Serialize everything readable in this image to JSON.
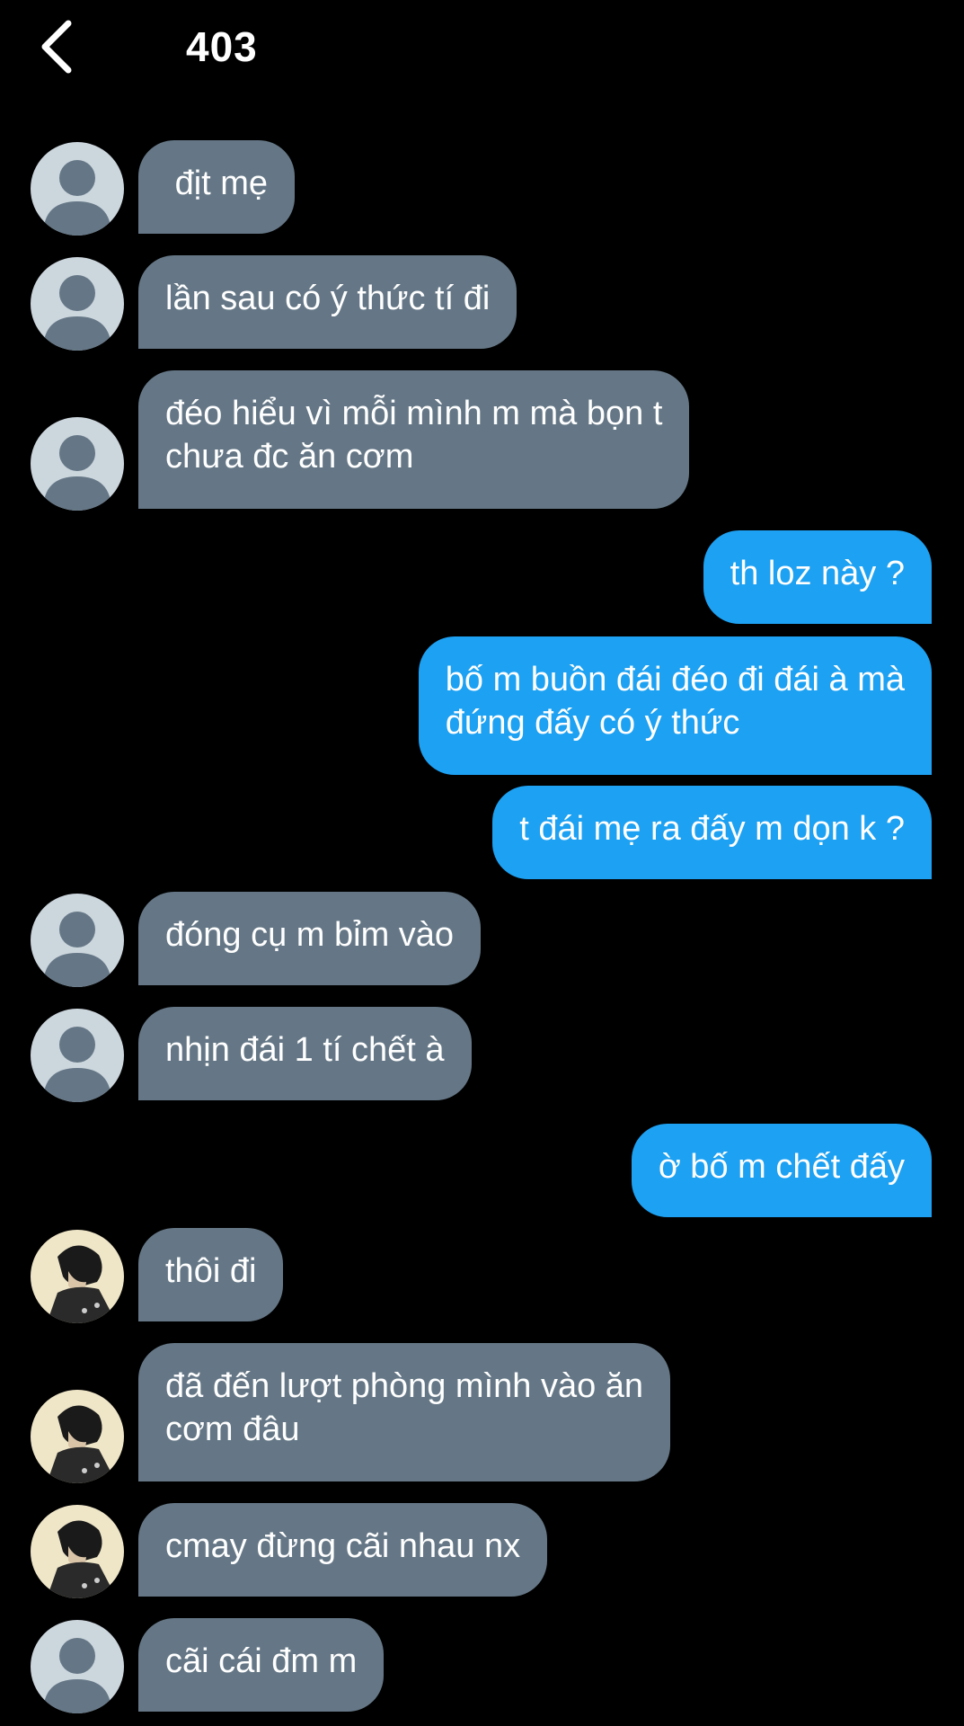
{
  "header": {
    "back_icon": "chevron-left-icon",
    "title": "403"
  },
  "colors": {
    "background": "#000000",
    "incoming_bubble": "#657786",
    "outgoing_bubble": "#1da1f2",
    "text": "#ffffff"
  },
  "messages": [
    {
      "direction": "incoming",
      "avatar": "default-avatar",
      "text": " địt mẹ"
    },
    {
      "direction": "incoming",
      "avatar": "default-avatar",
      "text": "lần sau có ý thức tí đi"
    },
    {
      "direction": "incoming",
      "avatar": "default-avatar",
      "text": "đéo hiểu vì mỗi mình m mà bọn t\nchưa đc ăn cơm"
    },
    {
      "direction": "outgoing",
      "text": "th loz này ?"
    },
    {
      "direction": "outgoing",
      "text": "bố m buồn đái đéo đi đái à mà\nđứng đấy có ý thức"
    },
    {
      "direction": "outgoing",
      "text": "t đái mẹ ra đấy m dọn k ?"
    },
    {
      "direction": "incoming",
      "avatar": "default-avatar",
      "text": "đóng cụ m bỉm vào"
    },
    {
      "direction": "incoming",
      "avatar": "default-avatar",
      "text": "nhịn đái 1 tí chết à"
    },
    {
      "direction": "outgoing",
      "text": "ờ bố m chết đấy"
    },
    {
      "direction": "incoming",
      "avatar": "photo-avatar",
      "text": "thôi đi"
    },
    {
      "direction": "incoming",
      "avatar": "photo-avatar",
      "text": "đã đến lượt phòng mình vào ăn\ncơm đâu"
    },
    {
      "direction": "incoming",
      "avatar": "photo-avatar",
      "text": "cmay đừng cãi nhau nx"
    },
    {
      "direction": "incoming",
      "avatar": "default-avatar",
      "text": "cãi cái đm m"
    }
  ]
}
